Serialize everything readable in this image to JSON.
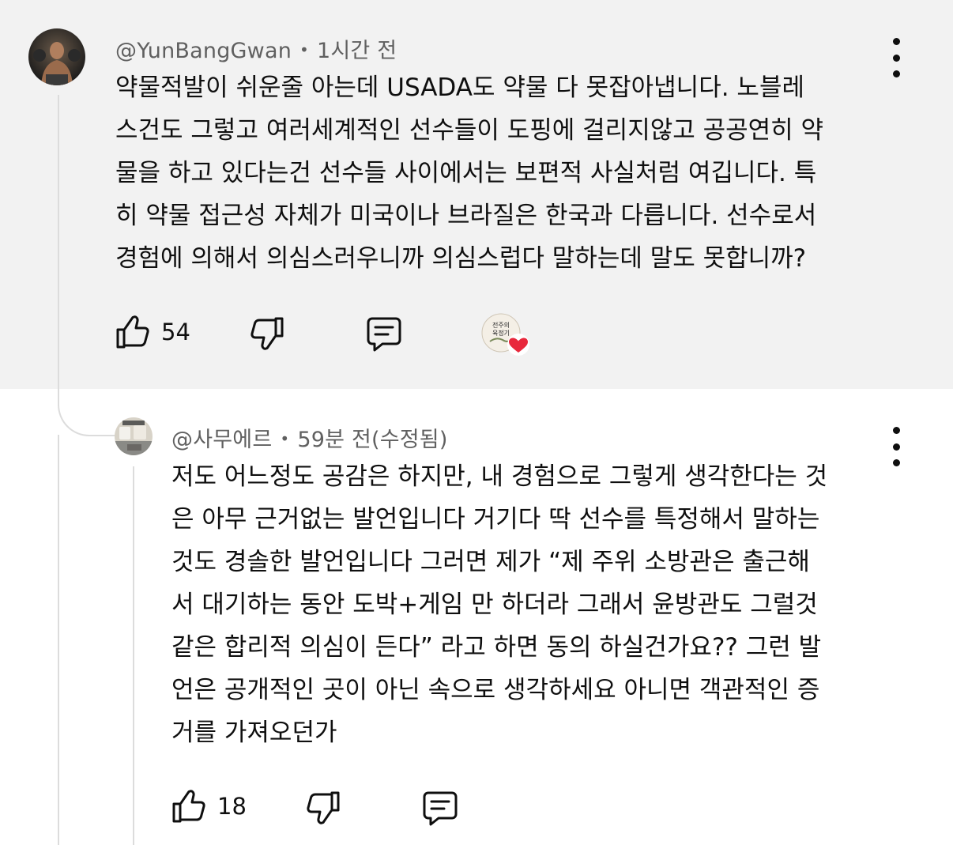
{
  "comment": {
    "author": "@YunBangGwan",
    "time": "1시간 전",
    "lines": [
      "약물적발이 쉬운줄 아는데 USADA도 약물 다 못잡아냅니다. 노블레",
      "스건도 그렇고 여러세계적인 선수들이 도핑에 걸리지않고 공공연히 약",
      "물을 하고 있다는건 선수들 사이에서는 보편적 사실처럼 여깁니다. 특",
      "히 약물 접근성 자체가 미국이나 브라질은 한국과 다릅니다. 선수로서",
      "경험에 의해서 의심스러우니까 의심스럽다 말하는데 말도 못합니까?"
    ],
    "like_count": "54",
    "icons": {
      "like": "thumbs-up-icon",
      "dislike": "thumbs-down-icon",
      "reply": "reply-icon",
      "more": "more-vert-icon",
      "creator_heart": "creator-heart-icon"
    },
    "creator_heart_avatar_text": [
      "전주의",
      "육정기"
    ]
  },
  "reply": {
    "author": "@사무에르",
    "time": "59분 전(수정됨)",
    "lines": [
      "저도 어느정도 공감은 하지만, 내 경험으로 그렇게 생각한다는 것",
      "은 아무 근거없는 발언입니다 거기다 딱 선수를 특정해서 말하는",
      "것도 경솔한 발언입니다 그러면 제가 “제 주위 소방관은 출근해",
      "서 대기하는 동안 도박+게임 만 하더라 그래서 윤방관도 그럴것",
      "같은 합리적 의심이 든다” 라고 하면 동의 하실건가요?? 그런 발",
      "언은 공개적인 곳이 아닌 속으로 생각하세요 아니면 객관적인 증",
      "거를 가져오던가"
    ],
    "like_count": "18"
  },
  "colors": {
    "highlight_bg": "#f2f2f2",
    "text": "#0f0f0f",
    "meta": "#606060",
    "heart": "#e8283c"
  }
}
